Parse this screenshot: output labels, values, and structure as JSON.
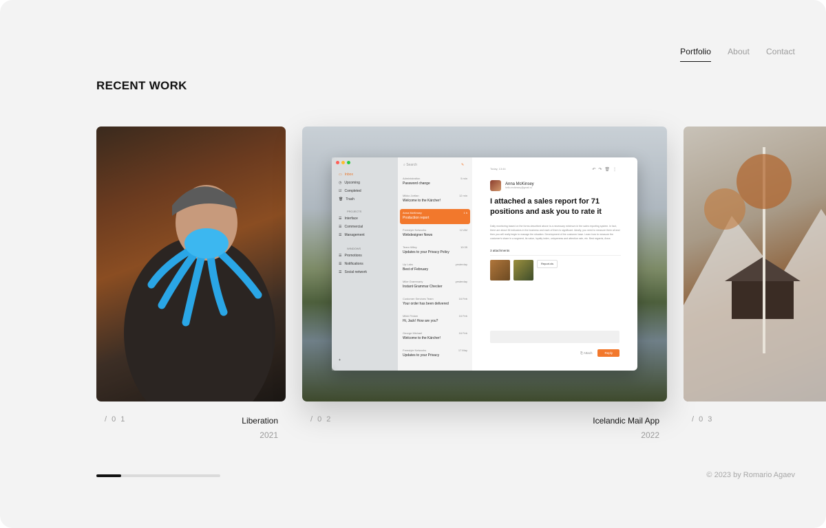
{
  "nav": {
    "items": [
      {
        "label": "Portfolio",
        "active": true
      },
      {
        "label": "About"
      },
      {
        "label": "Contact"
      }
    ]
  },
  "section_title": "RECENT WORK",
  "projects": [
    {
      "number": "/ 0 1",
      "name": "Liberation",
      "year": "2021"
    },
    {
      "number": "/ 0 2",
      "name": "Icelandic Mail App",
      "year": "2022"
    },
    {
      "number": "/ 0 3"
    }
  ],
  "mail": {
    "sidebar": [
      "Inbox",
      "Upcoming",
      "Completed",
      "Trash"
    ],
    "groups": [
      {
        "title": "PROJECTS",
        "items": [
          "Interface",
          "Commercial",
          "Management"
        ]
      },
      {
        "title": "WINDOWS",
        "items": [
          "Promotions",
          "Notifications",
          "Social network"
        ]
      }
    ],
    "search": "Search",
    "messages": [
      {
        "from": "Administration",
        "time": "5 min",
        "subject": "Password change"
      },
      {
        "from": "Mikko Jortlan",
        "time": "12 min",
        "subject": "Welcome to the Kärcher!"
      },
      {
        "from": "Anna McKinsey",
        "time": "1 h",
        "subject": "Production report",
        "selected": true
      },
      {
        "from": "Freestyle Networks",
        "time": "12 AM",
        "subject": "Webdesigner News"
      },
      {
        "from": "Team Wiley",
        "time": "10:35",
        "subject": "Updates to your Privacy Policy"
      },
      {
        "from": "Up Labs",
        "time": "yesterday",
        "subject": "Best of February"
      },
      {
        "from": "Mike Grammarly",
        "time": "yesterday",
        "subject": "Instant Grammar Checker"
      },
      {
        "from": "Customer Services Team",
        "time": "16 Feb",
        "subject": "Your order has been delivered"
      },
      {
        "from": "Mikki Finlam",
        "time": "16 Feb",
        "subject": "Hi, Jack! How are you?"
      },
      {
        "from": "George Michael",
        "time": "16 Feb",
        "subject": "Welcome to the Kärcher!"
      },
      {
        "from": "Freestyle Networks",
        "time": "17 May",
        "subject": "Updates to your Privacy"
      }
    ],
    "reading": {
      "date": "Today, 13:44",
      "name": "Anna McKinsey",
      "email": "hello.mckinsey@gmail.ru",
      "subject": "I attached a sales report for 71 positions and ask you to rate it",
      "body": "Daily monitoring based on the forms described above is a necessary minimum in the sales reporting system. In fact, there are about 36 indicators in the business and each of them is significant. Ideally, you need to measure them all and then you will really begin to manage the situation. Development of the customer base. Learn how to measure the customer's share in a segment, its value, loyalty index, uniqueness and attention rate, etc. Best regards, Anna",
      "attachments": "3 attachments",
      "chip": "Report.xls",
      "attach_label": "Attach",
      "reply_label": "Reply"
    }
  },
  "progress": 0.2,
  "copyright": "© 2023 by Romario Agaev",
  "colors": {
    "accent": "#f2782c",
    "text": "#111111",
    "muted": "#9a9a9a"
  }
}
